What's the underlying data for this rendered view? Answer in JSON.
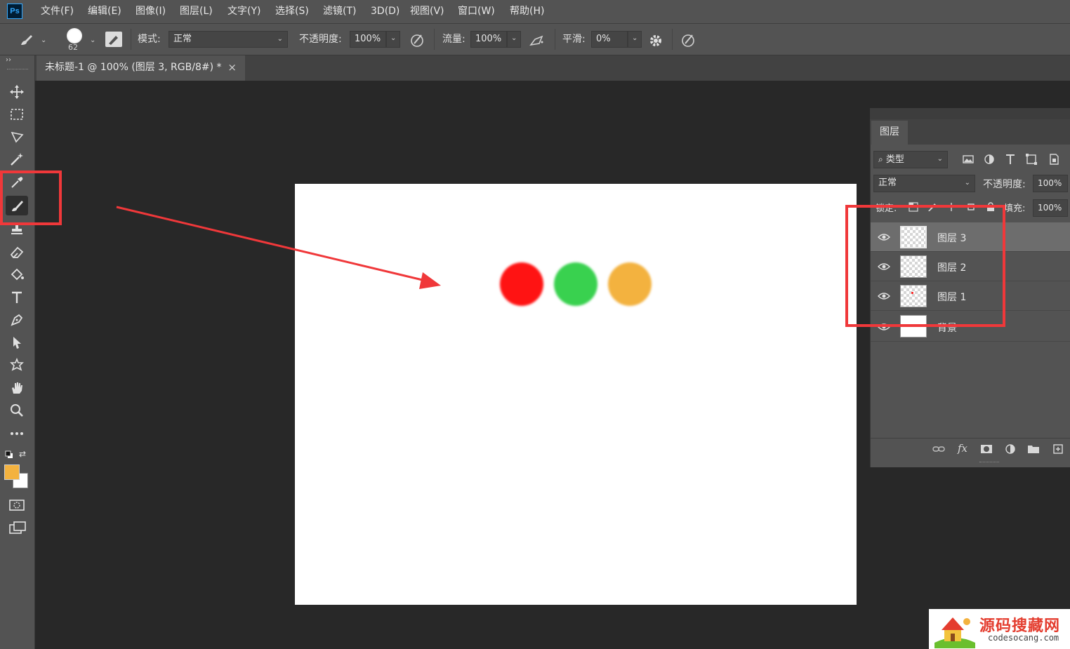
{
  "app": {
    "logo_text": "Ps"
  },
  "menu": [
    "文件(F)",
    "编辑(E)",
    "图像(I)",
    "图层(L)",
    "文字(Y)",
    "选择(S)",
    "滤镜(T)",
    "3D(D)",
    "视图(V)",
    "窗口(W)",
    "帮助(H)"
  ],
  "options_bar": {
    "brush_size": "62",
    "mode_label": "模式:",
    "mode_value": "正常",
    "opacity_label": "不透明度:",
    "opacity_value": "100%",
    "flow_label": "流量:",
    "flow_value": "100%",
    "smoothing_label": "平滑:",
    "smoothing_value": "0%"
  },
  "document_tab": {
    "title": "未标题-1 @ 100% (图层 3, RGB/8#) *",
    "close": "×"
  },
  "toolbar": {
    "collapse_glyph": "››",
    "tools": [
      "move-tool",
      "marquee-tool",
      "lasso-tool",
      "magic-wand-tool",
      "eyedropper-tool",
      "brush-tool",
      "stamp-tool",
      "eraser-tool",
      "paint-bucket-tool",
      "type-tool",
      "pen-tool",
      "path-selection-tool",
      "shape-tool",
      "hand-tool",
      "zoom-tool",
      "more-tools"
    ],
    "active_tool": "brush-tool",
    "foreground_color": "#f3b23f",
    "background_color": "#ffffff"
  },
  "canvas": {
    "background": "#ffffff",
    "circles": [
      {
        "name": "red-circle",
        "color": "#ff1313"
      },
      {
        "name": "green-circle",
        "color": "#39d14f"
      },
      {
        "name": "orange-circle",
        "color": "#f3b23f"
      }
    ]
  },
  "layers_panel": {
    "tab": "图层",
    "filter_label": "类型",
    "blend_mode": "正常",
    "opacity_label": "不透明度:",
    "opacity_value": "100%",
    "lock_label": "锁定:",
    "fill_label": "填充:",
    "fill_value": "100%",
    "layers": [
      {
        "name": "图层 3",
        "selected": true
      },
      {
        "name": "图层 2",
        "selected": false
      },
      {
        "name": "图层 1",
        "selected": false
      },
      {
        "name": "背景",
        "selected": false
      }
    ]
  },
  "annotation_color": "#f0383a",
  "watermark": {
    "title": "源码搜藏网",
    "url": "codesocang.com"
  }
}
